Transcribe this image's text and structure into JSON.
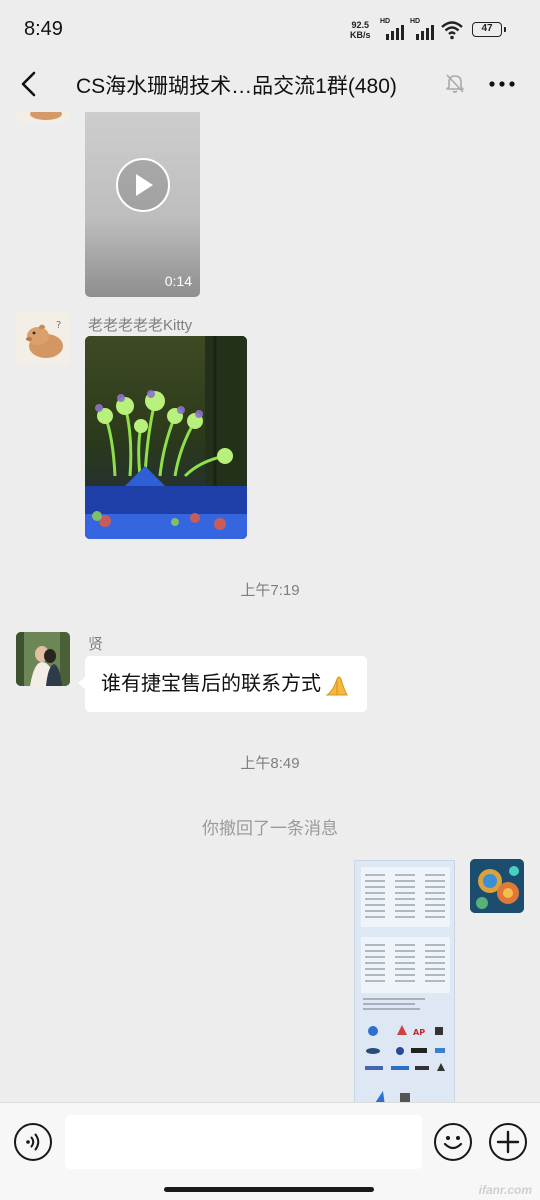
{
  "status_bar": {
    "time": "8:49",
    "net_speed_value": "92.5",
    "net_speed_unit": "KB/s",
    "signal1_label": "HD",
    "signal2_label": "HD",
    "battery": "47",
    "icons": [
      "signal-icon",
      "wifi-icon",
      "battery-icon"
    ]
  },
  "header": {
    "title": "CS海水珊瑚技术…品交流1群(480)",
    "back_icon": "chevron-left-icon",
    "mute_icon": "bell-off-icon",
    "more_icon": "more-dots-icon"
  },
  "messages": [
    {
      "type": "video",
      "duration": "0:14"
    },
    {
      "type": "image",
      "sender": "老老老老老Kitty",
      "content": "coral tank photo"
    },
    {
      "type": "time",
      "text": "上午7:19"
    },
    {
      "type": "text",
      "sender": "贤",
      "text": "谁有捷宝售后的联系方式"
    },
    {
      "type": "time",
      "text": "上午8:49"
    },
    {
      "type": "system",
      "text": "你撤回了一条消息"
    },
    {
      "type": "image",
      "sender": "self",
      "content": "price list document"
    }
  ],
  "input_bar": {
    "placeholder": "",
    "voice_icon": "voice-icon",
    "emoji_icon": "emoji-icon",
    "plus_icon": "plus-icon"
  },
  "watermark": "ifanr.com",
  "colors": {
    "background": "#ededed",
    "bubble": "#ffffff",
    "input_bar": "#f7f7f7"
  }
}
